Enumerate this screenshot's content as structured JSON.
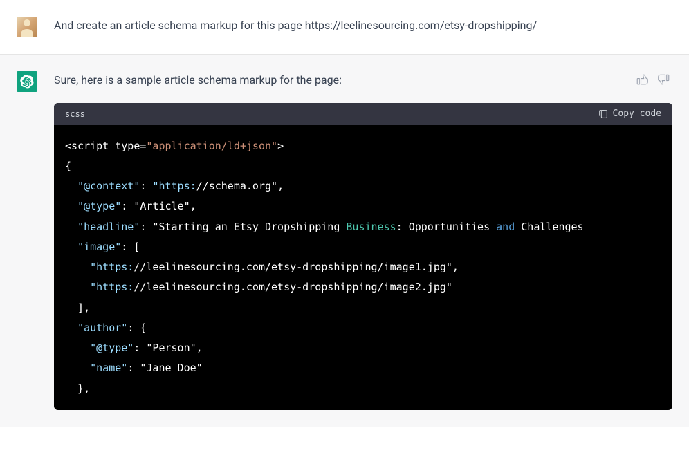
{
  "user": {
    "message_pre": "And create an article schema markup for this page ",
    "link": "https://leelinesourcing.com/etsy-dropshipping/"
  },
  "assistant": {
    "intro": "Sure, here is a sample article schema markup for the page:"
  },
  "code": {
    "lang": "scss",
    "copy_label": "Copy code",
    "lines": {
      "l1_open": "<script type=",
      "l1_attr": "\"application/ld+json\"",
      "l1_close": ">",
      "l2": "{",
      "l3_key": "\"@context\"",
      "l3_proto": "\"https:",
      "l3_rest": "//schema.org\"",
      "l4_key": "\"@type\"",
      "l4_val": "\"Article\"",
      "l5_key": "\"headline\"",
      "l5_val_a": "\"Starting an Etsy Dropshipping ",
      "l5_val_b": "Business",
      "l5_val_c": ": Opportunities ",
      "l5_val_d": "and",
      "l5_val_e": " Challenges",
      "l6_key": "\"image\"",
      "l6_br": " [",
      "l7_proto": "\"https:",
      "l7_rest": "//leelinesourcing.com/etsy-dropshipping/image1.jpg\"",
      "l8_proto": "\"https:",
      "l8_rest": "//leelinesourcing.com/etsy-dropshipping/image2.jpg\"",
      "l9": "  ],",
      "l10_key": "\"author\"",
      "l10_br": " {",
      "l11_key": "\"@type\"",
      "l11_val": "\"Person\"",
      "l12_key": "\"name\"",
      "l12_val": "\"Jane Doe\"",
      "l13": "  },"
    }
  }
}
